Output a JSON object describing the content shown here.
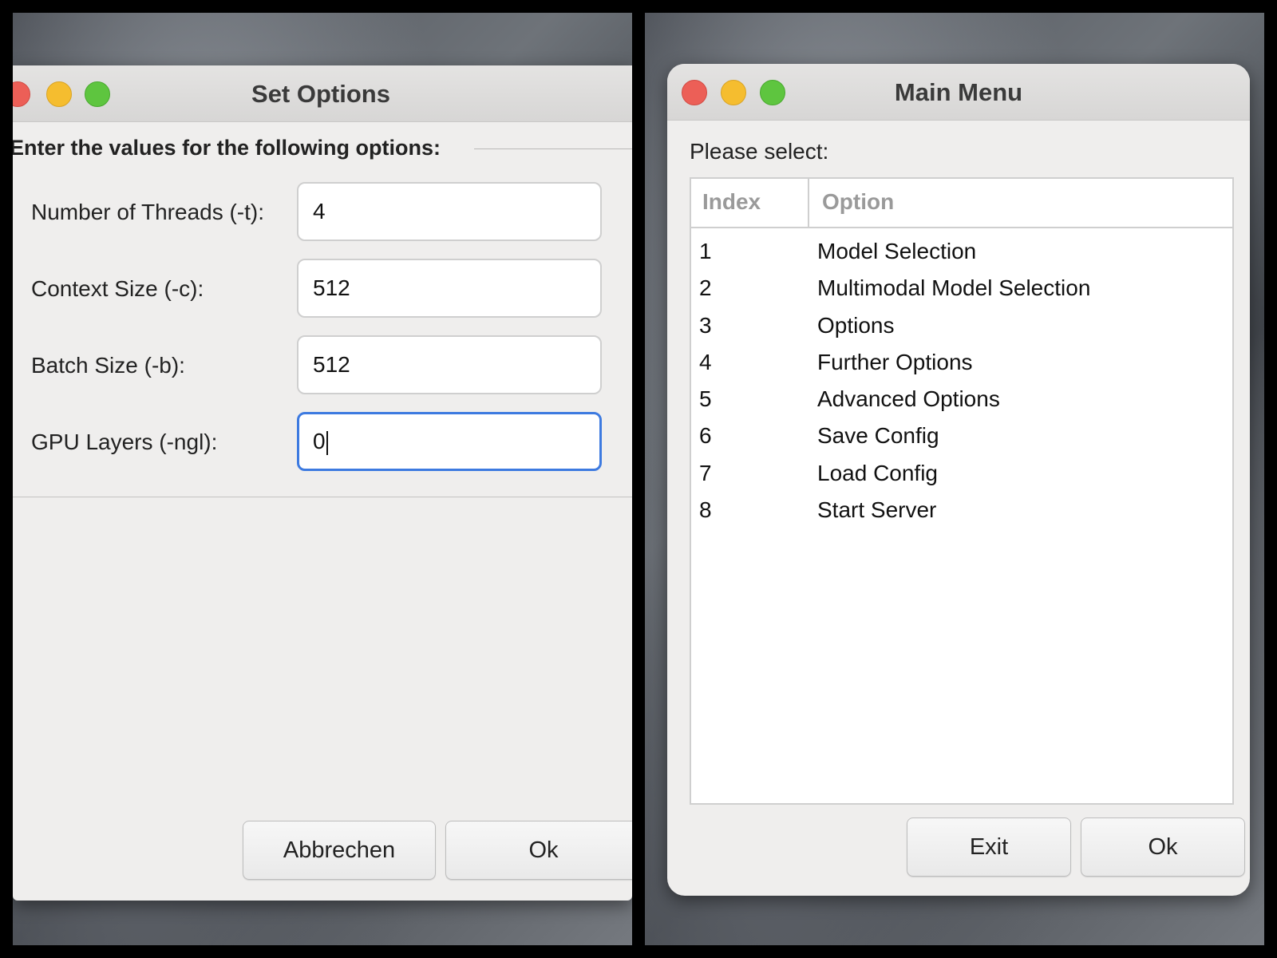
{
  "set_options": {
    "title": "Set Options",
    "heading": "Enter the values for the following options:",
    "fields": [
      {
        "label": "Number of Threads (-t):",
        "value": "4"
      },
      {
        "label": "Context Size (-c):",
        "value": "512"
      },
      {
        "label": "Batch Size (-b):",
        "value": "512"
      },
      {
        "label": "GPU Layers (-ngl):",
        "value": "0"
      }
    ],
    "cancel_label": "Abbrechen",
    "ok_label": "Ok"
  },
  "main_menu": {
    "title": "Main Menu",
    "prompt": "Please select:",
    "columns": [
      "Index",
      "Option"
    ],
    "rows": [
      {
        "index": "1",
        "option": "Model Selection"
      },
      {
        "index": "2",
        "option": "Multimodal Model Selection"
      },
      {
        "index": "3",
        "option": "Options"
      },
      {
        "index": "4",
        "option": "Further Options"
      },
      {
        "index": "5",
        "option": "Advanced Options"
      },
      {
        "index": "6",
        "option": "Save Config"
      },
      {
        "index": "7",
        "option": "Load Config"
      },
      {
        "index": "8",
        "option": "Start Server"
      }
    ],
    "exit_label": "Exit",
    "ok_label": "Ok"
  },
  "colors": {
    "focus_ring": "#3d7ae0",
    "close": "#ec5f57",
    "minimize": "#f5bd2f",
    "zoom": "#5ec53f"
  }
}
